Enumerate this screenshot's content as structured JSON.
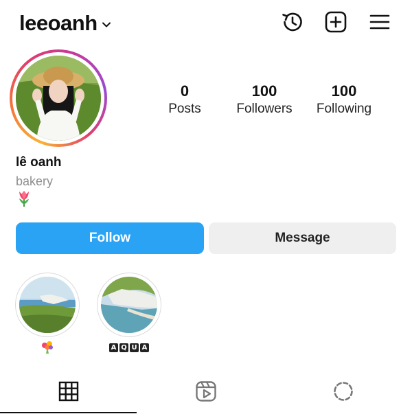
{
  "header": {
    "username": "leeoanh",
    "icons": [
      "chevron-down-icon",
      "history-icon",
      "new-post-icon",
      "menu-icon"
    ]
  },
  "profile": {
    "stats": [
      {
        "value": "0",
        "label": "Posts"
      },
      {
        "value": "100",
        "label": "Followers"
      },
      {
        "value": "100",
        "label": "Following"
      }
    ],
    "full_name": "lê oanh",
    "category": "bakery",
    "bio_icon": "tulip-emoji"
  },
  "actions": {
    "follow_label": "Follow",
    "message_label": "Message"
  },
  "highlights": [
    {
      "label_icon": "bouquet-emoji",
      "cover": "coastal-cliffs-photo"
    },
    {
      "label_letters": [
        "A",
        "Q",
        "U",
        "A"
      ],
      "cover": "white-cliffs-beach-photo"
    }
  ],
  "tabs": [
    "grid-icon",
    "reels-icon",
    "tagged-icon"
  ],
  "colors": {
    "accent": "#2aa3f4",
    "secondary_button": "#efefef",
    "muted_text": "#8e8e8e"
  }
}
